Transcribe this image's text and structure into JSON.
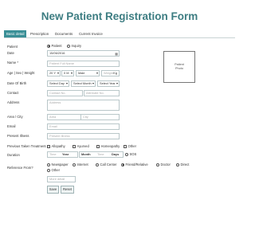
{
  "title": "New Patient Registration Form",
  "tabs": [
    "Basic detail",
    "Prescription",
    "Documents",
    "Current Invoice"
  ],
  "labels": {
    "patient": "Patient",
    "date": "Date",
    "name": "Name *",
    "age_sex_weight": "Age | Sex | Weight",
    "dob": "Date Of Birth",
    "contact": "Contact",
    "address": "Address",
    "area_city": "Area / City",
    "email": "Email",
    "present_illness": "Present Illness",
    "previous_treatment": "Previous Taken Treatment",
    "duration": "Duration",
    "reference_from": "Reference From?"
  },
  "patient_type": {
    "options": [
      "Patient",
      "Inquiry"
    ],
    "selected": "Patient"
  },
  "date": {
    "value": "15/06/2016",
    "icon": "calendar-icon"
  },
  "name": {
    "placeholder": "Patient Full Name"
  },
  "age": {
    "value": "20 Y",
    "month": "0 M",
    "sex": "Male",
    "weight_placeholder": "Weight",
    "weight_unit": "Kg"
  },
  "dob": {
    "day": "Select Day",
    "month": "Select Month",
    "year": "Select Year"
  },
  "contact": {
    "placeholder": "Contact No.",
    "alt_placeholder": "Alternate No."
  },
  "address": {
    "placeholder": "Address"
  },
  "area": {
    "placeholder": "Area",
    "city_placeholder": "City"
  },
  "email": {
    "placeholder": "Email"
  },
  "present_illness": {
    "placeholder": "Present Illness"
  },
  "treatment": {
    "options": [
      "Allopathy",
      "Ayurved",
      "Homeopathy",
      "Other"
    ]
  },
  "duration": {
    "time": "Time",
    "year": "Year",
    "month": "Month",
    "time2": "Time",
    "days": "Days",
    "sos": "SOS"
  },
  "reference": {
    "options": [
      "Newspaper",
      "Internet",
      "Call Center",
      "Friend/Relative",
      "Doctor",
      "Direct",
      "Other"
    ],
    "selected": "Friend/Relative",
    "more_placeholder": "More detail"
  },
  "photo": {
    "line1": "Patient",
    "line2": "Photo"
  },
  "buttons": {
    "save": "Save",
    "reset": "Reset"
  }
}
